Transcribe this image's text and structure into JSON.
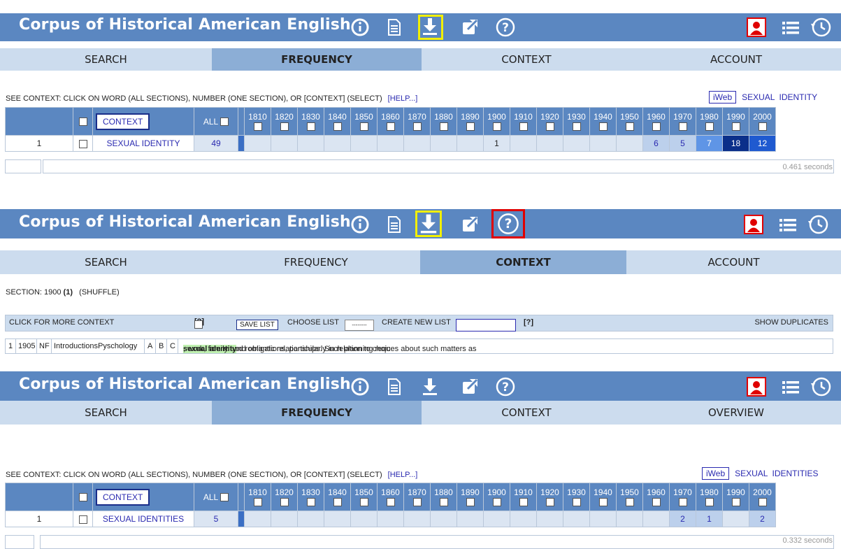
{
  "app_title": "Corpus of Historical American English",
  "icons": [
    "info-icon",
    "document-icon",
    "download-icon",
    "external-link-icon",
    "help-icon",
    "user-icon",
    "list-icon",
    "history-icon"
  ],
  "colors": {
    "header": "#5b87c1",
    "nav": "#ccdcee",
    "active_tab": "#8caed6",
    "highlight_yellow": "#f2ef00",
    "highlight_red": "#e00000"
  },
  "panel1": {
    "tabs": [
      "SEARCH",
      "FREQUENCY",
      "CONTEXT",
      "ACCOUNT"
    ],
    "active_tab": "FREQUENCY",
    "see_context": "SEE CONTEXT: CLICK ON WORD (ALL SECTIONS), NUMBER (ONE SECTION), OR [CONTEXT] (SELECT)",
    "help": "[HELP...]",
    "iweb": "iWeb",
    "query_words": [
      "SEXUAL",
      "IDENTITY"
    ],
    "context_button": "CONTEXT",
    "all_label": "ALL",
    "decades": [
      "1810",
      "1820",
      "1830",
      "1840",
      "1850",
      "1860",
      "1870",
      "1880",
      "1890",
      "1900",
      "1910",
      "1920",
      "1930",
      "1940",
      "1950",
      "1960",
      "1970",
      "1980",
      "1990",
      "2000"
    ],
    "row": {
      "rank": "1",
      "word": "SEXUAL IDENTITY",
      "total": "49",
      "counts": [
        "",
        "",
        "",
        "",
        "",
        "",
        "",
        "",
        "",
        "1",
        "",
        "",
        "",
        "",
        "",
        "6",
        "5",
        "7",
        "18",
        "12"
      ]
    },
    "seconds": "0.461 seconds"
  },
  "panel2": {
    "tabs": [
      "SEARCH",
      "FREQUENCY",
      "CONTEXT",
      "ACCOUNT"
    ],
    "active_tab": "CONTEXT",
    "section_label": "SECTION: 1900",
    "section_count": "(1)",
    "shuffle": "(SHUFFLE)",
    "click_more": "CLICK FOR MORE CONTEXT",
    "q1": "[?]",
    "save_list": "SAVE LIST",
    "choose_list": "CHOOSE LIST",
    "choose_value": "--------",
    "create_new_list": "CREATE NEW LIST",
    "q2": "[?]",
    "show_duplicates": "SHOW DUPLICATES",
    "kwic": {
      "num": "1",
      "year": "1905",
      "genre": "NF",
      "source": "IntroductionsPyschology",
      "a": "A",
      "b": "B",
      "c": "C",
      "left": "new demands and obligations, particularly in relation to choices about such matters as",
      "keyword": "sexual identity",
      "right": ", work, family and romantic relationships. Such planning requ"
    }
  },
  "panel3": {
    "tabs": [
      "SEARCH",
      "FREQUENCY",
      "CONTEXT",
      "OVERVIEW"
    ],
    "active_tab": "FREQUENCY",
    "see_context": "SEE CONTEXT: CLICK ON WORD (ALL SECTIONS), NUMBER (ONE SECTION), OR [CONTEXT] (SELECT)",
    "help": "[HELP...]",
    "iweb": "iWeb",
    "query_words": [
      "SEXUAL",
      "IDENTITIES"
    ],
    "context_button": "CONTEXT",
    "all_label": "ALL",
    "decades": [
      "1810",
      "1820",
      "1830",
      "1840",
      "1850",
      "1860",
      "1870",
      "1880",
      "1890",
      "1900",
      "1910",
      "1920",
      "1930",
      "1940",
      "1950",
      "1960",
      "1970",
      "1980",
      "1990",
      "2000"
    ],
    "row": {
      "rank": "1",
      "word": "SEXUAL IDENTITIES",
      "total": "5",
      "counts": [
        "",
        "",
        "",
        "",
        "",
        "",
        "",
        "",
        "",
        "",
        "",
        "",
        "",
        "",
        "",
        "",
        "2",
        "1",
        "",
        "2"
      ]
    },
    "seconds": "0.332 seconds"
  }
}
